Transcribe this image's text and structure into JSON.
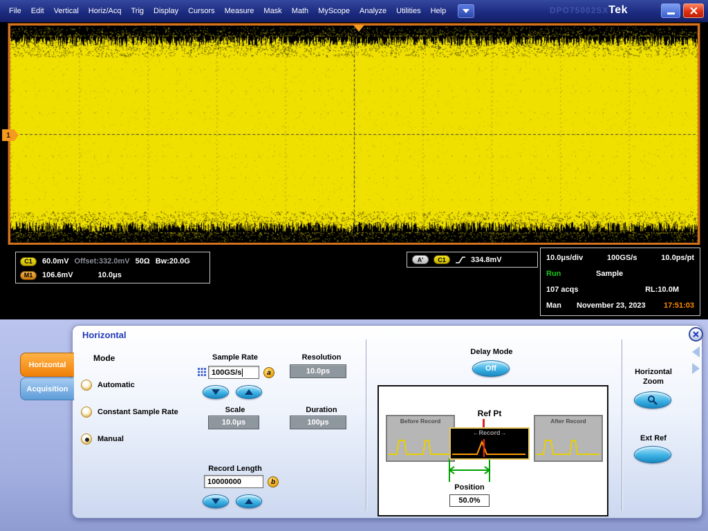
{
  "menu": {
    "items": [
      "File",
      "Edit",
      "Vertical",
      "Horiz/Acq",
      "Trig",
      "Display",
      "Cursors",
      "Measure",
      "Mask",
      "Math",
      "MyScope",
      "Analyze",
      "Utilities",
      "Help"
    ],
    "logo": "Tek",
    "watermark": "DPO75002SX"
  },
  "display": {
    "channel_marker": "1"
  },
  "readouts": {
    "ch1": {
      "badge": "C1",
      "scale": "60.0mV",
      "offset": "Offset:332.0mV",
      "impedance": "50Ω",
      "bandwidth": "Bw:20.0G"
    },
    "m1": {
      "badge": "M1",
      "scale": "106.6mV",
      "timebase": "10.0μs"
    },
    "trigger": {
      "system": "A'",
      "source": "C1",
      "level": "334.8mV"
    },
    "status": {
      "timebase": "10.0μs/div",
      "samplerate": "100GS/s",
      "resolution": "10.0ps/pt",
      "state": "Run",
      "acq_mode": "Sample",
      "acquisitions": "107 acqs",
      "record_length": "RL:10.0M",
      "trig_mode": "Man",
      "date": "November 23, 2023",
      "time": "17:51:03"
    }
  },
  "dialog": {
    "title": "Horizontal",
    "tabs": [
      {
        "label": "Horizontal"
      },
      {
        "label": "Acquisition"
      }
    ],
    "mode": {
      "heading": "Mode",
      "options": [
        "Automatic",
        "Constant Sample Rate",
        "Manual"
      ],
      "selected": "Manual"
    },
    "sample_rate": {
      "label": "Sample Rate",
      "value": "100GS/s",
      "badge": "a"
    },
    "scale": {
      "label": "Scale",
      "value": "10.0μs"
    },
    "record_length": {
      "label": "Record Length",
      "value": "10000000",
      "badge": "b"
    },
    "resolution": {
      "label": "Resolution",
      "value": "10.0ps"
    },
    "duration": {
      "label": "Duration",
      "value": "100μs"
    },
    "delay_mode": {
      "label": "Delay Mode",
      "value": "Off"
    },
    "diagram": {
      "before": "Before Record",
      "after": "After Record",
      "ref_pt": "Ref Pt",
      "record": "←Record→",
      "position_label": "Position",
      "position_value": "50.0%"
    },
    "zoom_label": "Horizontal Zoom",
    "ext_ref_label": "Ext Ref"
  }
}
